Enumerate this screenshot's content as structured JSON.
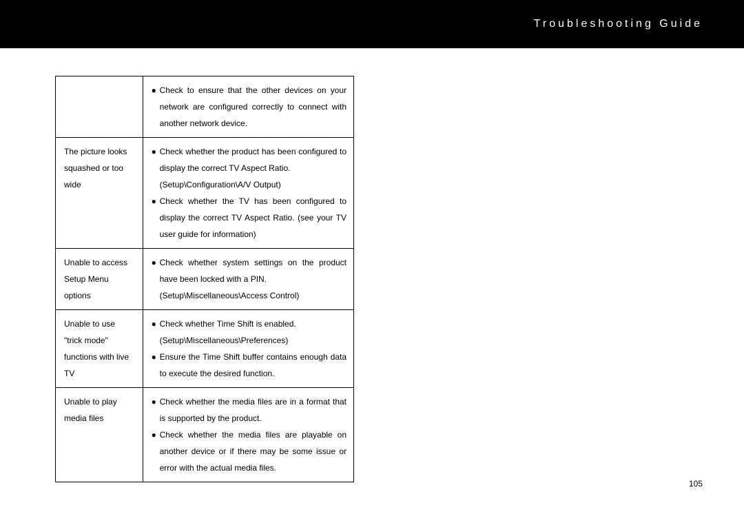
{
  "header": {
    "title": "Troubleshooting Guide"
  },
  "table": {
    "rows": [
      {
        "problem": "",
        "solutions": [
          {
            "bullet": "●",
            "text": "Check to ensure that the other devices on your network are configured correctly to connect with another network device."
          }
        ]
      },
      {
        "problem": "The picture looks squashed or too wide",
        "solutions": [
          {
            "bullet": "●",
            "text": "Check whether the product has been configured to display the correct TV Aspect Ratio.",
            "path": "(Setup\\Configuration\\A/V Output)"
          },
          {
            "bullet": "●",
            "text": "Check whether the TV has been configured to display the correct TV Aspect Ratio. (see your TV user guide for information)"
          }
        ]
      },
      {
        "problem": "Unable to access Setup Menu options",
        "solutions": [
          {
            "bullet": "●",
            "text": "Check whether system settings on the product have been locked with a PIN.",
            "path": "(Setup\\Miscellaneous\\Access Control)"
          }
        ]
      },
      {
        "problem": "Unable to use \"trick mode\" functions with live TV",
        "solutions": [
          {
            "bullet": "●",
            "text": "Check whether Time Shift is enabled.",
            "path": "(Setup\\Miscellaneous\\Preferences)"
          },
          {
            "bullet": "●",
            "text": "Ensure the Time Shift buffer contains enough data to execute the desired function."
          }
        ]
      },
      {
        "problem": "Unable to play media files",
        "solutions": [
          {
            "bullet": "●",
            "text": "Check whether the media files are in a format that is supported by the product."
          },
          {
            "bullet": "●",
            "text": "Check whether the media files are playable on another device or if there may be some issue or error with the actual media files."
          }
        ]
      }
    ]
  },
  "page_number": "105"
}
